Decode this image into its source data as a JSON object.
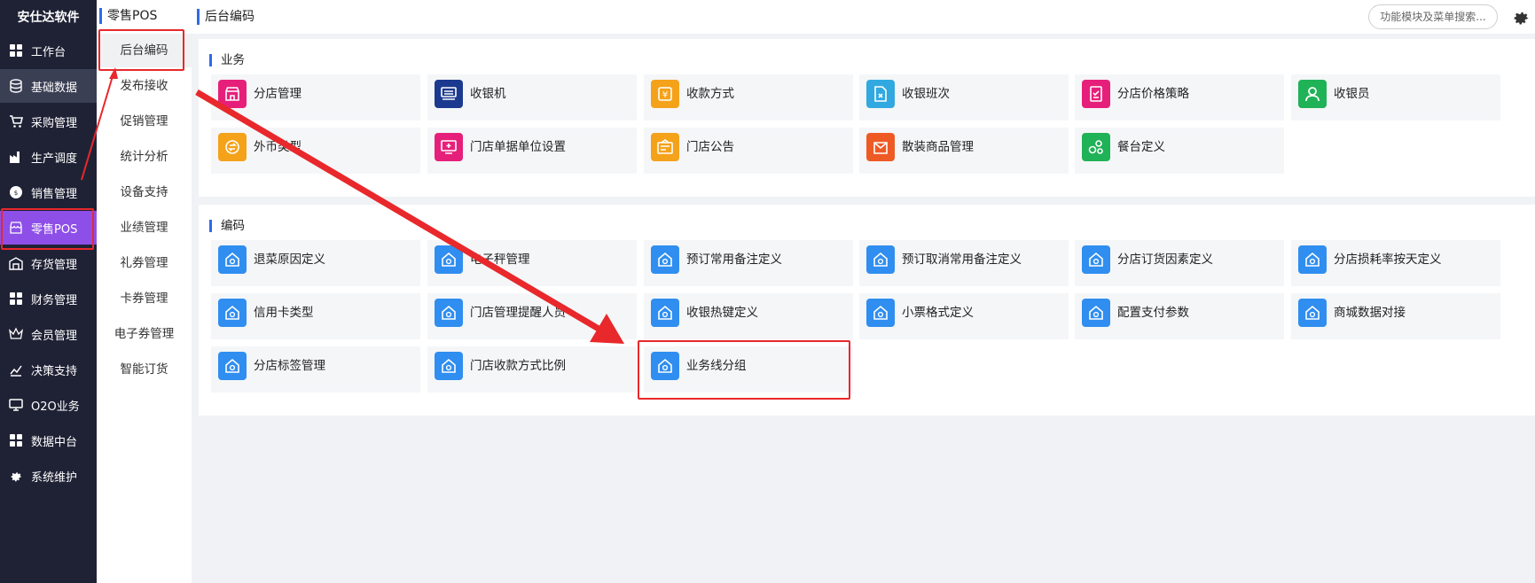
{
  "brand": "安仕达软件",
  "sidebar": {
    "items": [
      {
        "label": "工作台",
        "icon": "grid-icon"
      },
      {
        "label": "基础数据",
        "icon": "database-icon"
      },
      {
        "label": "采购管理",
        "icon": "cart-icon"
      },
      {
        "label": "生产调度",
        "icon": "factory-icon"
      },
      {
        "label": "销售管理",
        "icon": "sales-icon"
      },
      {
        "label": "零售POS",
        "icon": "store-icon"
      },
      {
        "label": "存货管理",
        "icon": "warehouse-icon"
      },
      {
        "label": "财务管理",
        "icon": "grid-icon"
      },
      {
        "label": "会员管理",
        "icon": "crown-icon"
      },
      {
        "label": "决策支持",
        "icon": "chart-icon"
      },
      {
        "label": "O2O业务",
        "icon": "monitor-icon"
      },
      {
        "label": "数据中台",
        "icon": "grid-icon"
      },
      {
        "label": "系统维护",
        "icon": "gear-icon"
      }
    ]
  },
  "submenu": {
    "title": "零售POS",
    "items": [
      "后台编码",
      "发布接收",
      "促销管理",
      "统计分析",
      "设备支持",
      "业绩管理",
      "礼券管理",
      "卡券管理",
      "电子券管理",
      "智能订货"
    ]
  },
  "topbar": {
    "breadcrumb": "后台编码",
    "search_placeholder": "功能模块及菜单搜索..."
  },
  "sections": {
    "business": {
      "title": "业务",
      "tiles": [
        {
          "label": "分店管理",
          "icon": "shop-icon",
          "color": "#e6207a"
        },
        {
          "label": "收银机",
          "icon": "cash-register-icon",
          "color": "#1b3a8f"
        },
        {
          "label": "收款方式",
          "icon": "yen-icon",
          "color": "#f5a21b"
        },
        {
          "label": "收银班次",
          "icon": "document-icon",
          "color": "#31a9e0"
        },
        {
          "label": "分店价格策略",
          "icon": "checklist-icon",
          "color": "#e6207a"
        },
        {
          "label": "收银员",
          "icon": "user-icon",
          "color": "#1fb256"
        },
        {
          "label": "外币类型",
          "icon": "exchange-icon",
          "color": "#f5a21b"
        },
        {
          "label": "门店单据单位设置",
          "icon": "monitor-plus-icon",
          "color": "#e6207a"
        },
        {
          "label": "门店公告",
          "icon": "notice-icon",
          "color": "#f5a21b"
        },
        {
          "label": "散装商品管理",
          "icon": "bag-icon",
          "color": "#ee5a24"
        },
        {
          "label": "餐台定义",
          "icon": "circles-icon",
          "color": "#1fb256"
        }
      ]
    },
    "coding": {
      "title": "编码",
      "tiles": [
        {
          "label": "退菜原因定义"
        },
        {
          "label": "电子秤管理"
        },
        {
          "label": "预订常用备注定义"
        },
        {
          "label": "预订取消常用备注定义"
        },
        {
          "label": "分店订货因素定义"
        },
        {
          "label": "分店损耗率按天定义"
        },
        {
          "label": "信用卡类型"
        },
        {
          "label": "门店管理提醒人员"
        },
        {
          "label": "收银热键定义"
        },
        {
          "label": "小票格式定义"
        },
        {
          "label": "配置支付参数"
        },
        {
          "label": "商城数据对接"
        },
        {
          "label": "分店标签管理"
        },
        {
          "label": "门店收款方式比例"
        },
        {
          "label": "业务线分组"
        }
      ],
      "tile_color": "#2f8ef0",
      "tile_icon": "home-icon"
    }
  },
  "accent": "#2f6be8",
  "annotation_color": "#e8282b"
}
